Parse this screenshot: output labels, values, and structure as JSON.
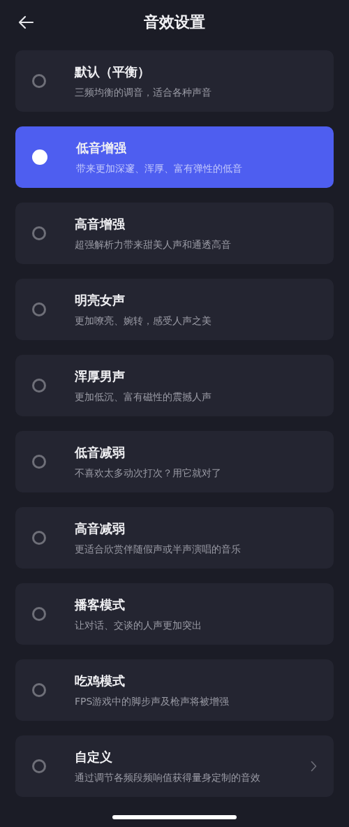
{
  "header": {
    "title": "音效设置"
  },
  "options": [
    {
      "title": "默认（平衡）",
      "description": "三频均衡的调音，适合各种声音",
      "selected": false,
      "has_more": false
    },
    {
      "title": "低音增强",
      "description": "带来更加深邃、浑厚、富有弹性的低音",
      "selected": true,
      "has_more": false
    },
    {
      "title": "高音增强",
      "description": "超强解析力带来甜美人声和通透高音",
      "selected": false,
      "has_more": false
    },
    {
      "title": "明亮女声",
      "description": "更加嘹亮、婉转，感受人声之美",
      "selected": false,
      "has_more": false
    },
    {
      "title": "浑厚男声",
      "description": "更加低沉、富有磁性的震撼人声",
      "selected": false,
      "has_more": false
    },
    {
      "title": "低音减弱",
      "description": "不喜欢太多动次打次？用它就对了",
      "selected": false,
      "has_more": false
    },
    {
      "title": "高音减弱",
      "description": "更适合欣赏伴随假声或半声演唱的音乐",
      "selected": false,
      "has_more": false
    },
    {
      "title": "播客模式",
      "description": "让对话、交谈的人声更加突出",
      "selected": false,
      "has_more": false
    },
    {
      "title": "吃鸡模式",
      "description": "FPS游戏中的脚步声及枪声将被增强",
      "selected": false,
      "has_more": false
    },
    {
      "title": "自定义",
      "description": "通过调节各频段频响值获得量身定制的音效",
      "selected": false,
      "has_more": true
    }
  ]
}
